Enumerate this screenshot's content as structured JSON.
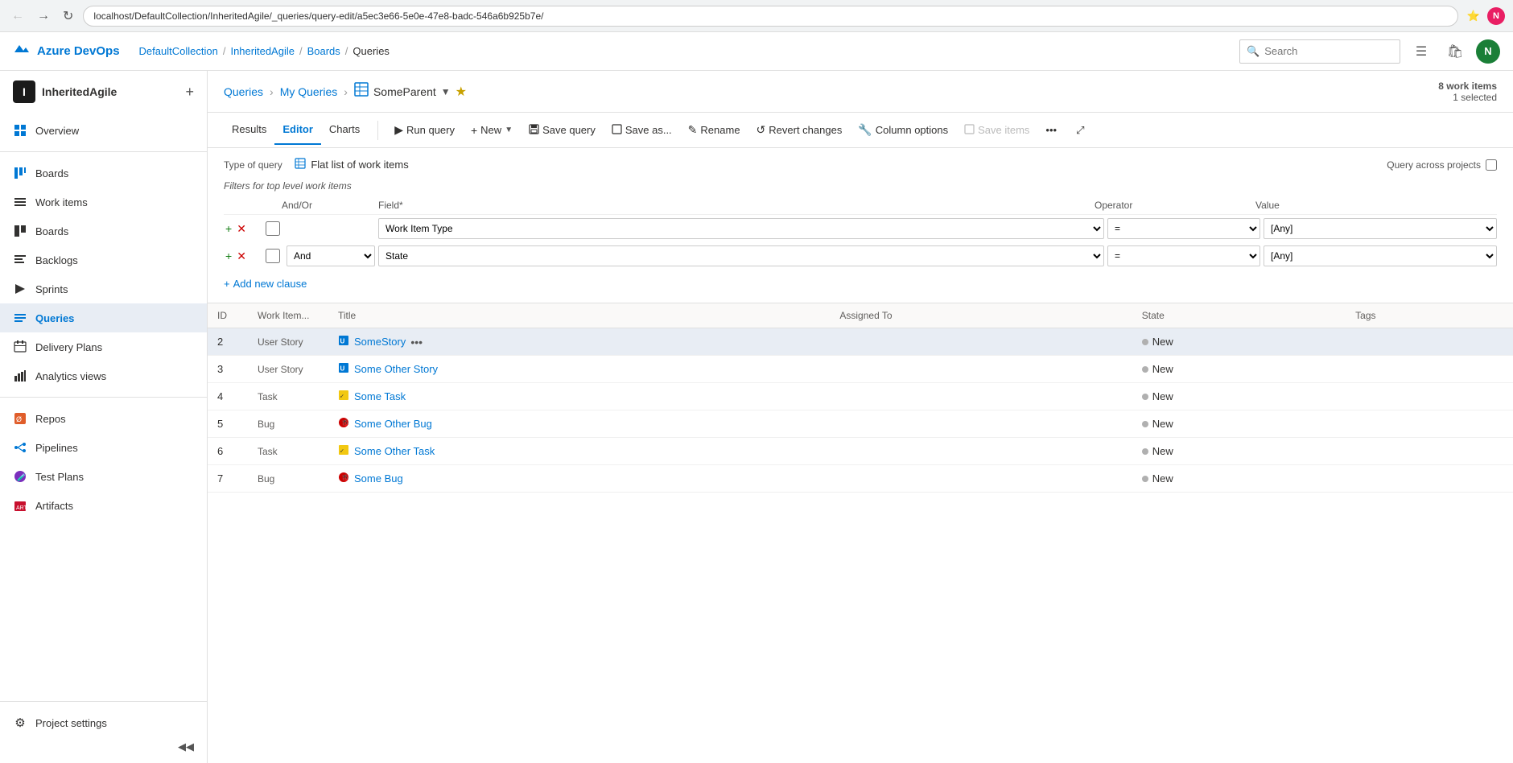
{
  "browser": {
    "url": "localhost/DefaultCollection/InheritedAgile/_queries/query-edit/a5ec3e66-5e0e-47e8-badc-546a6b925b7e/",
    "search_placeholder": "Search"
  },
  "topnav": {
    "logo_text": "Azure DevOps",
    "breadcrumb": [
      {
        "label": "DefaultCollection",
        "sep": "/"
      },
      {
        "label": "InheritedAgile",
        "sep": "/"
      },
      {
        "label": "Boards",
        "sep": "/"
      },
      {
        "label": "Queries",
        "sep": ""
      }
    ],
    "search_placeholder": "Search"
  },
  "sidebar": {
    "org_initial": "I",
    "org_name": "InheritedAgile",
    "items": [
      {
        "id": "overview",
        "label": "Overview",
        "icon": "⊞"
      },
      {
        "id": "boards-section",
        "label": "Boards",
        "icon": "⬜",
        "is_section": true
      },
      {
        "id": "work-items",
        "label": "Work items",
        "icon": "☰"
      },
      {
        "id": "boards",
        "label": "Boards",
        "icon": "⊞"
      },
      {
        "id": "backlogs",
        "label": "Backlogs",
        "icon": "☰"
      },
      {
        "id": "sprints",
        "label": "Sprints",
        "icon": "⚡"
      },
      {
        "id": "queries",
        "label": "Queries",
        "icon": "⊟"
      },
      {
        "id": "delivery-plans",
        "label": "Delivery Plans",
        "icon": "📅"
      },
      {
        "id": "analytics-views",
        "label": "Analytics views",
        "icon": "📊"
      },
      {
        "id": "repos",
        "label": "Repos",
        "icon": "📁"
      },
      {
        "id": "pipelines",
        "label": "Pipelines",
        "icon": "⚙"
      },
      {
        "id": "test-plans",
        "label": "Test Plans",
        "icon": "🧪"
      },
      {
        "id": "artifacts",
        "label": "Artifacts",
        "icon": "📦"
      }
    ],
    "footer": {
      "project_settings": "Project settings",
      "collapse_label": "◀"
    }
  },
  "page": {
    "breadcrumb": {
      "queries_label": "Queries",
      "my_queries_label": "My Queries",
      "current_label": "SomeParent"
    },
    "work_items_count": "8 work items",
    "selected_count": "1 selected"
  },
  "tabs": {
    "results": "Results",
    "editor": "Editor",
    "charts": "Charts"
  },
  "toolbar": {
    "run_query": "Run query",
    "new": "New",
    "save_query": "Save query",
    "save_as": "Save as...",
    "rename": "Rename",
    "revert_changes": "Revert changes",
    "column_options": "Column options",
    "save_items": "Save items"
  },
  "query_editor": {
    "type_label": "Type of query",
    "type_value": "Flat list of work items",
    "query_across_label": "Query across projects",
    "filters_label": "Filters for top level work items",
    "col_andor": "And/Or",
    "col_field": "Field*",
    "col_operator": "Operator",
    "col_value": "Value",
    "rows": [
      {
        "id": 1,
        "andor": "",
        "field": "Work Item Type",
        "operator": "=",
        "value": "[Any]"
      },
      {
        "id": 2,
        "andor": "And",
        "field": "State",
        "operator": "=",
        "value": "[Any]"
      }
    ],
    "add_clause": "Add new clause"
  },
  "results": {
    "columns": [
      {
        "id": "col-id",
        "label": "ID"
      },
      {
        "id": "col-wi-type",
        "label": "Work Item..."
      },
      {
        "id": "col-title",
        "label": "Title"
      },
      {
        "id": "col-assigned",
        "label": "Assigned To"
      },
      {
        "id": "col-state",
        "label": "State"
      },
      {
        "id": "col-tags",
        "label": "Tags"
      }
    ],
    "rows": [
      {
        "id": 2,
        "wi_type": "User Story",
        "wi_type_icon": "story",
        "title": "SomeStory",
        "assigned_to": "",
        "state": "New",
        "tags": "",
        "selected": true,
        "show_more": true
      },
      {
        "id": 3,
        "wi_type": "User Story",
        "wi_type_icon": "story",
        "title": "Some Other Story",
        "assigned_to": "",
        "state": "New",
        "tags": "",
        "selected": false,
        "show_more": false
      },
      {
        "id": 4,
        "wi_type": "Task",
        "wi_type_icon": "task",
        "title": "Some Task",
        "assigned_to": "",
        "state": "New",
        "tags": "",
        "selected": false,
        "show_more": false
      },
      {
        "id": 5,
        "wi_type": "Bug",
        "wi_type_icon": "bug",
        "title": "Some Other Bug",
        "assigned_to": "",
        "state": "New",
        "tags": "",
        "selected": false,
        "show_more": false
      },
      {
        "id": 6,
        "wi_type": "Task",
        "wi_type_icon": "task",
        "title": "Some Other Task",
        "assigned_to": "",
        "state": "New",
        "tags": "",
        "selected": false,
        "show_more": false
      },
      {
        "id": 7,
        "wi_type": "Bug",
        "wi_type_icon": "bug",
        "title": "Some Bug",
        "assigned_to": "",
        "state": "New",
        "tags": "",
        "selected": false,
        "show_more": false
      }
    ]
  }
}
